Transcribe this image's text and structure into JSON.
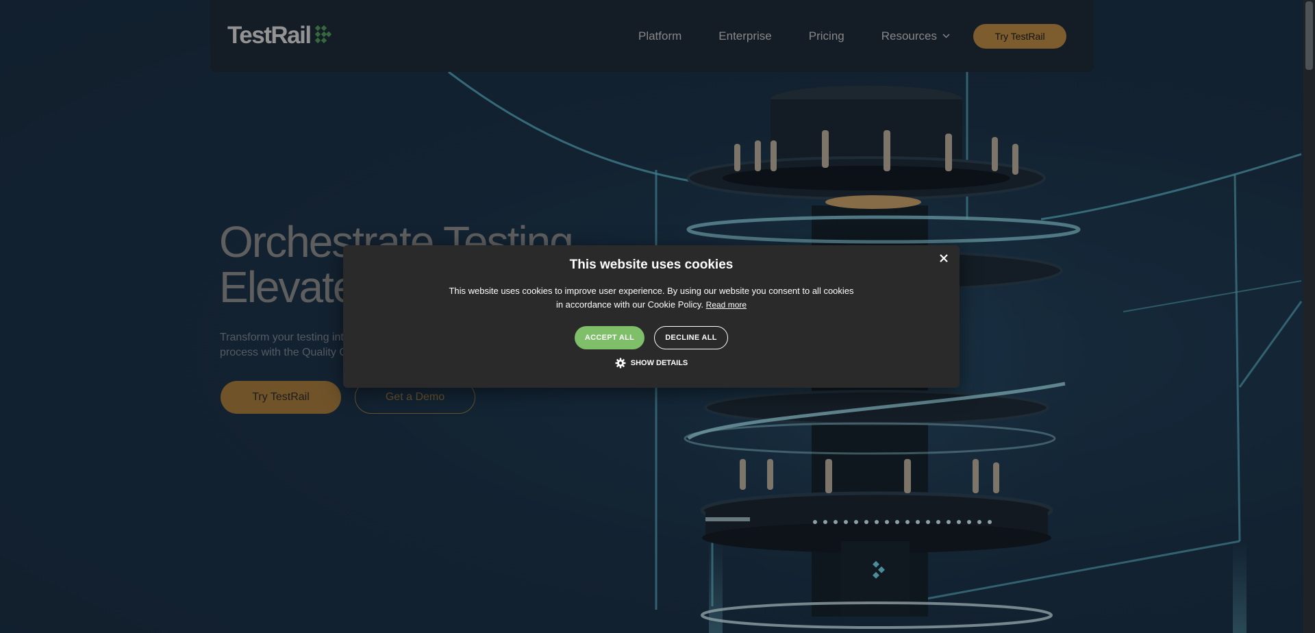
{
  "brand": {
    "logo_text": "TestRail",
    "accent_color": "#b88a45",
    "logo_mark_color": "#4e9a5a"
  },
  "nav": {
    "links": [
      {
        "label": "Platform"
      },
      {
        "label": "Enterprise"
      },
      {
        "label": "Pricing"
      },
      {
        "label": "Resources",
        "icon": "chevron-down-icon"
      }
    ],
    "cta_label": "Try TestRail"
  },
  "hero": {
    "title_line1": "Orchestrate Testing",
    "title_line2": "Elevate",
    "subtitle_line1": "Transform your testing int",
    "subtitle_line2": "process with the Quality C",
    "primary_button": "Try TestRail",
    "secondary_button": "Get a Demo"
  },
  "cookie_dialog": {
    "title": "This website uses cookies",
    "body_line1": "This website uses cookies to improve user experience. By using our website you consent to all cookies",
    "body_line2": "in accordance with our Cookie Policy.",
    "read_more": "Read more",
    "accept_label": "ACCEPT ALL",
    "decline_label": "DECLINE ALL",
    "show_details_label": "SHOW DETAILS",
    "accept_color": "#7fbf6a"
  }
}
